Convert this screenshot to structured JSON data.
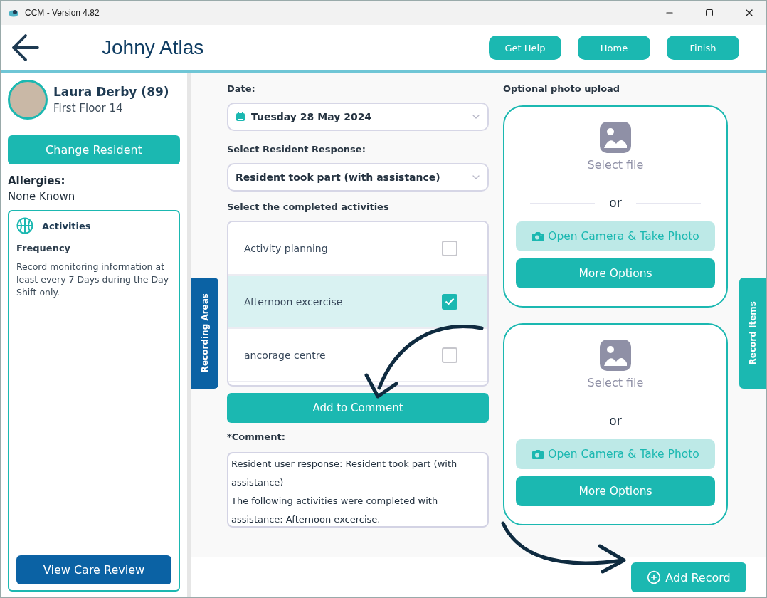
{
  "window": {
    "title": "CCM - Version 4.82"
  },
  "header": {
    "title": "Johny Atlas",
    "buttons": [
      "Get Help",
      "Home",
      "Finish"
    ]
  },
  "resident": {
    "name": "Laura Derby (89)",
    "location": "First Floor 14",
    "change_button": "Change Resident"
  },
  "allergies": {
    "label": "Allergies:",
    "value": "None Known"
  },
  "care_area": {
    "title": "Activities",
    "frequency_label": "Frequency",
    "frequency_text": "Record monitoring information at least every 7 Days during the Day Shift only.",
    "button": "View Care Review"
  },
  "side_tabs": {
    "left": "Recording Areas",
    "right": "Record Items"
  },
  "form": {
    "date_label": "Date:",
    "date_value": "Tuesday 28 May 2024",
    "response_label": "Select Resident Response:",
    "response_value": "Resident took part (with assistance)",
    "activities_label": "Select the completed activities",
    "activities": [
      {
        "label": "Activity planning",
        "checked": false
      },
      {
        "label": "Afternoon excercise",
        "checked": true
      },
      {
        "label": "ancorage centre",
        "checked": false
      }
    ],
    "add_button": "Add to Comment",
    "comment_label": "*Comment:",
    "comment": "Resident user response: Resident took part (with assistance)\nThe following activities were completed with assistance: Afternoon excercise."
  },
  "photo": {
    "label": "Optional photo upload",
    "cards": [
      {
        "select_text": "Select file",
        "or_text": "or",
        "camera_button": "Open Camera & Take Photo",
        "more_button": "More Options"
      },
      {
        "select_text": "Select file",
        "or_text": "or",
        "camera_button": "Open Camera & Take Photo",
        "more_button": "More Options"
      }
    ]
  },
  "footer": {
    "add_record_button": "Add Record"
  }
}
